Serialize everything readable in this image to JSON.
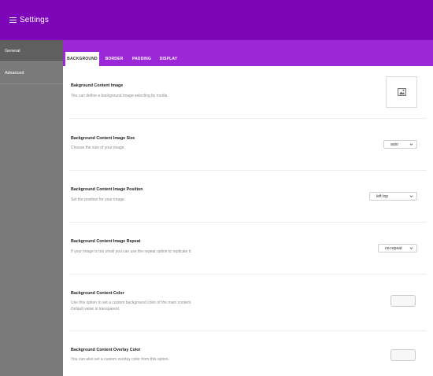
{
  "header": {
    "title": "Settings"
  },
  "sidebar": {
    "items": [
      {
        "label": "General"
      },
      {
        "label": "Advanced"
      }
    ]
  },
  "tabs": [
    {
      "label": "BACKGROUND"
    },
    {
      "label": "BORDER"
    },
    {
      "label": "PADDING"
    },
    {
      "label": "DISPLAY"
    }
  ],
  "rows": {
    "image": {
      "title": "Bakground Content Image",
      "desc": "You can define a background image selecting by media."
    },
    "size": {
      "title": "Background Content Image Size",
      "desc": "Choose the size of your image.",
      "value": "auto"
    },
    "position": {
      "title": "Background Content Image Position",
      "desc": "Set the position for your image.",
      "value": "left top"
    },
    "repeat": {
      "title": "Background Content Image Repeat",
      "desc": "If your image is too small you can use the repeat option to replicate it.",
      "value": "no-repeat"
    },
    "color": {
      "title": "Background Content Color",
      "desc1": "Use this option to set a custom background color of the main content.",
      "desc2": "Default value is transparent."
    },
    "overlay": {
      "title": "Background Content Overlay Color",
      "desc": "You can also set a custom overlay color from this option."
    }
  }
}
